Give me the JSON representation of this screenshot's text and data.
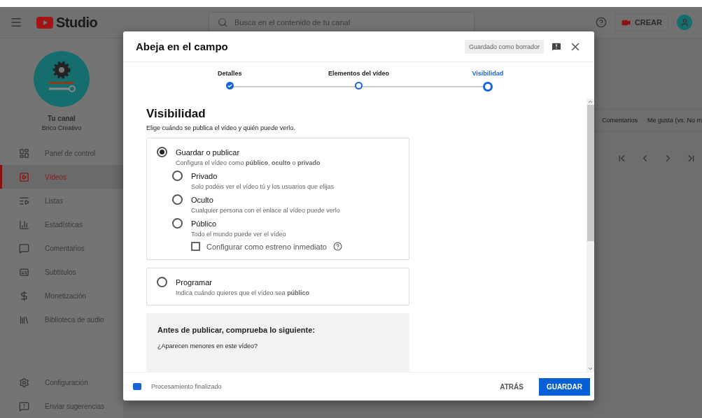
{
  "header": {
    "logo_text": "Studio",
    "search_placeholder": "Busca en el contenido de tu canal",
    "create_label": "CREAR"
  },
  "sidebar": {
    "channel_title": "Tu canal",
    "channel_name": "Brico Creativo",
    "items": [
      {
        "label": "Panel de control",
        "selected": false
      },
      {
        "label": "Vídeos",
        "selected": true
      },
      {
        "label": "Listas",
        "selected": false
      },
      {
        "label": "Estadísticas",
        "selected": false
      },
      {
        "label": "Comentarios",
        "selected": false
      },
      {
        "label": "Subtítulos",
        "selected": false
      },
      {
        "label": "Monetización",
        "selected": false
      },
      {
        "label": "Biblioteca de audio",
        "selected": false
      }
    ],
    "bottom_items": [
      {
        "label": "Configuración"
      },
      {
        "label": "Enviar sugerencias"
      }
    ]
  },
  "background": {
    "columns": [
      "Comentarios",
      "Me gusta (vs. No m"
    ]
  },
  "dialog": {
    "title": "Abeja en el campo",
    "status_badge": "Guardado como borrador",
    "steps": [
      {
        "label": "Detalles",
        "selected": false,
        "done": true
      },
      {
        "label": "Elementos del vídeo",
        "selected": false,
        "done": false
      },
      {
        "label": "Visibilidad",
        "selected": true,
        "done": false
      }
    ],
    "heading": "Visibilidad",
    "subheading": "Elige cuándo se publica el vídeo y quién puede verlo.",
    "options": [
      {
        "label": "Guardar o publicar",
        "description": "Configura el vídeo como **público**, **oculto** o **privado**",
        "selected": true,
        "children": [
          {
            "label": "Privado",
            "description": "Solo podéis ver el vídeo tú y los usuarios que elijas",
            "selected": false
          },
          {
            "label": "Oculto",
            "description": "Cualquier persona con el enlace al vídeo puede verlo",
            "selected": false
          },
          {
            "label": "Público",
            "description": "Todo el mundo puede ver el vídeo",
            "selected": false
          }
        ],
        "checkbox": {
          "label": "Configurar como estreno inmediato",
          "checked": false
        }
      },
      {
        "label": "Programar",
        "description": "Indica cuándo quieres que el vídeo sea **público**",
        "selected": false
      }
    ],
    "checklist": {
      "title": "Antes de publicar, comprueba lo siguiente:",
      "question": "¿Aparecen menores en este vídeo?"
    },
    "footer": {
      "status": "Procesamiento finalizado",
      "back_label": "ATRÁS",
      "save_label": "GUARDAR"
    }
  }
}
